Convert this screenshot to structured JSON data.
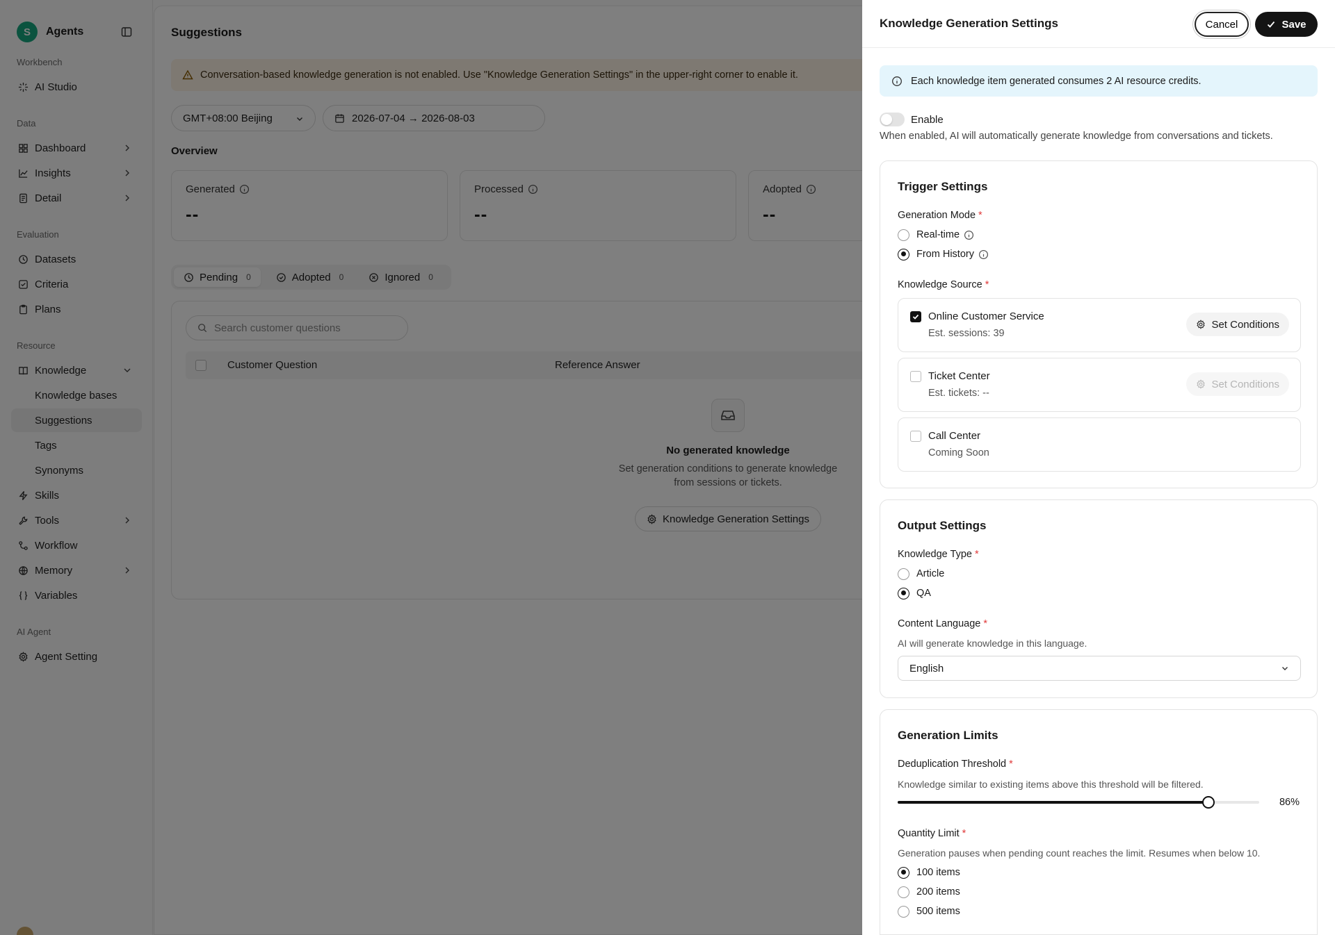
{
  "sidebar": {
    "brand_initial": "S",
    "brand_name": "Agents",
    "sections": {
      "workbench": "Workbench",
      "data": "Data",
      "evaluation": "Evaluation",
      "resource": "Resource",
      "ai_agent": "AI Agent"
    },
    "items": {
      "ai_studio": "AI Studio",
      "dashboard": "Dashboard",
      "insights": "Insights",
      "detail": "Detail",
      "datasets": "Datasets",
      "criteria": "Criteria",
      "plans": "Plans",
      "knowledge": "Knowledge",
      "knowledge_bases": "Knowledge bases",
      "suggestions": "Suggestions",
      "tags": "Tags",
      "synonyms": "Synonyms",
      "skills": "Skills",
      "tools": "Tools",
      "workflow": "Workflow",
      "memory": "Memory",
      "variables": "Variables",
      "agent_setting": "Agent Setting"
    }
  },
  "main": {
    "title": "Suggestions",
    "warning": "Conversation-based knowledge generation is not enabled. Use \"Knowledge Generation Settings\" in the upper-right corner to enable it.",
    "timezone": "GMT+08:00 Beijing",
    "date_range": "2026-07-04 → 2026-08-03",
    "overview_label": "Overview",
    "stats": [
      {
        "label": "Generated",
        "value": "--"
      },
      {
        "label": "Processed",
        "value": "--"
      },
      {
        "label": "Adopted",
        "value": "--"
      }
    ],
    "tabs": [
      {
        "label": "Pending",
        "count": "0"
      },
      {
        "label": "Adopted",
        "count": "0"
      },
      {
        "label": "Ignored",
        "count": "0"
      }
    ],
    "search_placeholder": "Search customer questions",
    "columns": [
      "Customer Question",
      "Reference Answer"
    ],
    "empty_title": "No generated knowledge",
    "empty_desc_1": "Set generation conditions to generate knowledge",
    "empty_desc_2": "from sessions or tickets.",
    "empty_button": "Knowledge Generation Settings"
  },
  "drawer": {
    "title": "Knowledge Generation Settings",
    "cancel": "Cancel",
    "save": "Save",
    "info": "Each knowledge item generated consumes 2 AI resource credits.",
    "enable_label": "Enable",
    "enable_on": false,
    "enable_desc": "When enabled, AI will automatically generate knowledge from conversations and tickets.",
    "trigger": {
      "title": "Trigger Settings",
      "mode_label": "Generation Mode",
      "mode_options": [
        "Real-time",
        "From History"
      ],
      "mode_selected": "From History",
      "source_label": "Knowledge Source",
      "sources": [
        {
          "name": "Online Customer Service",
          "sub": "Est. sessions: 39",
          "checked": true,
          "button": "Set Conditions"
        },
        {
          "name": "Ticket Center",
          "sub": "Est. tickets: --",
          "checked": false,
          "button": "Set Conditions"
        },
        {
          "name": "Call Center",
          "sub": "Coming Soon",
          "checked": false
        }
      ]
    },
    "output": {
      "title": "Output Settings",
      "type_label": "Knowledge Type",
      "type_options": [
        "Article",
        "QA"
      ],
      "type_selected": "QA",
      "language_label": "Content Language",
      "language_desc": "AI will generate knowledge in this language.",
      "language_value": "English"
    },
    "limits": {
      "title": "Generation Limits",
      "dedup_label": "Deduplication Threshold",
      "dedup_desc": "Knowledge similar to existing items above this threshold will be filtered.",
      "dedup_value": 86,
      "dedup_display": "86%",
      "quantity_label": "Quantity Limit",
      "quantity_desc": "Generation pauses when pending count reaches the limit. Resumes when below 10.",
      "quantity_options": [
        "100 items",
        "200 items",
        "500 items"
      ],
      "quantity_selected": "100 items"
    }
  },
  "colors": {
    "brand": "#17a67e",
    "warning_bg": "#fdf3e4",
    "info_bg": "#e4f5fc",
    "required": "#e03a3a",
    "primary": "#141414"
  }
}
